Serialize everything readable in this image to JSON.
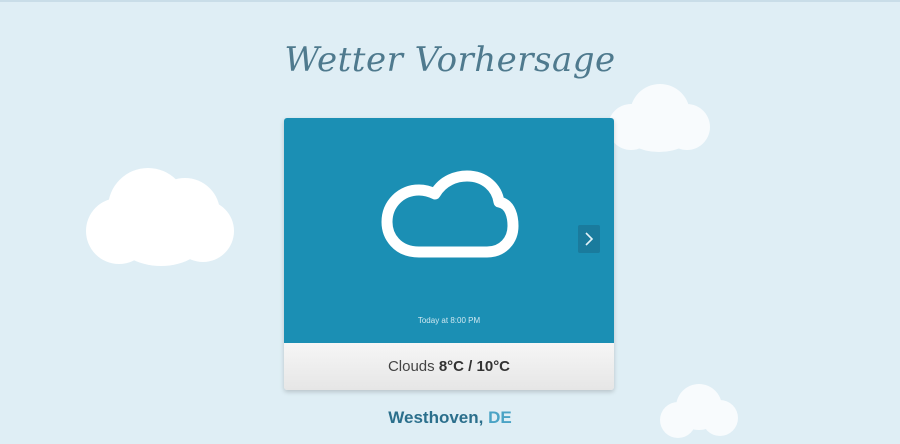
{
  "page": {
    "title": "Wetter Vorhersage"
  },
  "card": {
    "icon": "cloud-icon",
    "next_icon": "chevron-right-icon",
    "time_label": "Today at 8:00 PM",
    "condition": "Clouds",
    "temperature": "8°C / 10°C"
  },
  "location": {
    "city": "Westhoven",
    "country": "DE"
  },
  "colors": {
    "background": "#dfeef5",
    "card_top": "#1b8fb4",
    "title": "#4f7a8e",
    "city": "#2b6f8c",
    "country": "#4aa3c5"
  }
}
